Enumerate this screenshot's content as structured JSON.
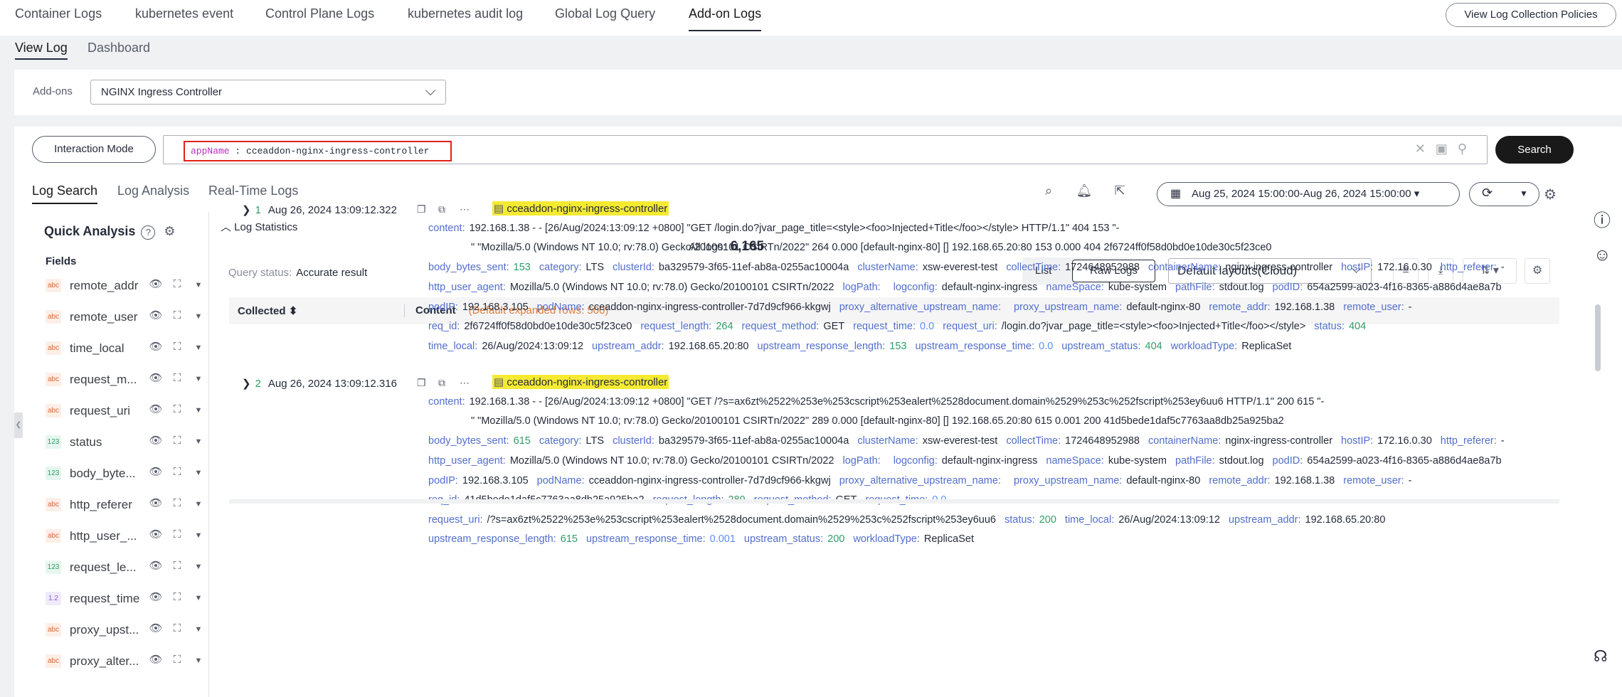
{
  "top_tabs": [
    "Container Logs",
    "kubernetes event",
    "Control Plane Logs",
    "kubernetes audit log",
    "Global Log Query",
    "Add-on Logs"
  ],
  "view_log_collection": "View Log Collection Policies",
  "sub_tabs": [
    "View Log",
    "Dashboard"
  ],
  "addons": {
    "label": "Add-ons",
    "selected": "NGINX Ingress Controller"
  },
  "interaction_mode": "Interaction Mode",
  "query": {
    "key": "appName",
    "rest": " : cceaddon-nginx-ingress-controller"
  },
  "search_label": "Search",
  "log_tabs": [
    "Log Search",
    "Log Analysis",
    "Real-Time Logs"
  ],
  "time_range": "Aug 25, 2024 15:00:00-Aug 26, 2024 15:00:00 ▾",
  "quick_analysis": {
    "title": "Quick Analysis",
    "fields_label": "Fields",
    "fields": [
      {
        "type": "abc",
        "name": "remote_addr"
      },
      {
        "type": "abc",
        "name": "remote_user"
      },
      {
        "type": "abc",
        "name": "time_local"
      },
      {
        "type": "abc",
        "name": "request_m..."
      },
      {
        "type": "abc",
        "name": "request_uri"
      },
      {
        "type": "123",
        "name": "status"
      },
      {
        "type": "123",
        "name": "body_byte..."
      },
      {
        "type": "abc",
        "name": "http_referer"
      },
      {
        "type": "abc",
        "name": "http_user_..."
      },
      {
        "type": "123",
        "name": "request_le..."
      },
      {
        "type": "1.2",
        "name": "request_time"
      },
      {
        "type": "abc",
        "name": "proxy_upst..."
      },
      {
        "type": "abc",
        "name": "proxy_alter..."
      }
    ]
  },
  "log_statistics": "Log Statistics",
  "all_logs": {
    "label": "All logs:",
    "count": "6,165"
  },
  "query_status": {
    "label": "Query status:",
    "value": "Accurate result"
  },
  "view_modes": {
    "list": "List",
    "raw": "Raw Logs"
  },
  "layout_select": "Default layouts(Cloud)",
  "table": {
    "col_collected": "Collected",
    "col_content": "Content",
    "expanded_note": "(Default expanded rows: 500)"
  },
  "rows": [
    {
      "num": "1",
      "time": "Aug 26, 2024 13:09:12.322",
      "app": "cceaddon-nginx-ingress-controller",
      "content1": "192.168.1.38 - - [26/Aug/2024:13:09:12 +0800] \"GET /login.do?jvar_page_title=<style><foo>Injected+Title</foo></style> HTTP/1.1\" 404 153 \"-",
      "content2": "\" \"Mozilla/5.0 (Windows NT 10.0; rv:78.0) Gecko/20100101 CSIRTn/2022\" 264 0.000 [default-nginx-80] [] 192.168.65.20:80 153 0.000 404 2f6724ff0f58d0bd0e10de30c5f23ce0",
      "body_bytes_sent": "153",
      "category": "LTS",
      "clusterId": "ba329579-3f65-11ef-ab8a-0255ac10004a",
      "clusterName": "xsw-everest-test",
      "collectTime": "1724648952988",
      "containerName": "nginx-ingress-controller",
      "hostIP": "172.16.0.30",
      "http_referer": "-",
      "http_user_agent": "Mozilla/5.0 (Windows NT 10.0; rv:78.0) Gecko/20100101 CSIRTn/2022",
      "logPath": "",
      "logconfig": "default-nginx-ingress",
      "nameSpace": "kube-system",
      "pathFile": "stdout.log",
      "podID": "654a2599-a023-4f16-8365-a886d4ae8a7b",
      "podIP": "192.168.3.105",
      "podName": "cceaddon-nginx-ingress-controller-7d7d9cf966-kkgwj",
      "proxy_alternative_upstream_name": "",
      "proxy_upstream_name": "default-nginx-80",
      "remote_addr": "192.168.1.38",
      "remote_user": "-",
      "req_id": "2f6724ff0f58d0bd0e10de30c5f23ce0",
      "request_length": "264",
      "request_method": "GET",
      "request_time": "0.0",
      "request_uri": "/login.do?jvar_page_title=<style><foo>Injected+Title</foo></style>",
      "status": "404",
      "time_local": "26/Aug/2024:13:09:12",
      "upstream_addr": "192.168.65.20:80",
      "upstream_response_length": "153",
      "upstream_response_time": "0.0",
      "upstream_status": "404",
      "workloadType": "ReplicaSet"
    },
    {
      "num": "2",
      "time": "Aug 26, 2024 13:09:12.316",
      "app": "cceaddon-nginx-ingress-controller",
      "content1": "192.168.1.38 - - [26/Aug/2024:13:09:12 +0800] \"GET /?s=ax6zt%2522%253e%253cscript%253ealert%2528document.domain%2529%253c%252fscript%253ey6uu6 HTTP/1.1\" 200 615 \"-",
      "content2": "\" \"Mozilla/5.0 (Windows NT 10.0; rv:78.0) Gecko/20100101 CSIRTn/2022\" 289 0.000 [default-nginx-80] [] 192.168.65.20:80 615 0.001 200 41d5bede1daf5c7763aa8db25a925ba2",
      "body_bytes_sent": "615",
      "category": "LTS",
      "clusterId": "ba329579-3f65-11ef-ab8a-0255ac10004a",
      "clusterName": "xsw-everest-test",
      "collectTime": "1724648952988",
      "containerName": "nginx-ingress-controller",
      "hostIP": "172.16.0.30",
      "http_referer": "-",
      "http_user_agent": "Mozilla/5.0 (Windows NT 10.0; rv:78.0) Gecko/20100101 CSIRTn/2022",
      "logPath": "",
      "logconfig": "default-nginx-ingress",
      "nameSpace": "kube-system",
      "pathFile": "stdout.log",
      "podID": "654a2599-a023-4f16-8365-a886d4ae8a7b",
      "podIP": "192.168.3.105",
      "podName": "cceaddon-nginx-ingress-controller-7d7d9cf966-kkgwj",
      "proxy_alternative_upstream_name": "",
      "proxy_upstream_name": "default-nginx-80",
      "remote_addr": "192.168.1.38",
      "remote_user": "-",
      "req_id": "41d5bede1daf5c7763aa8db25a925ba2",
      "request_length": "289",
      "request_method": "GET",
      "request_time": "0.0",
      "request_uri": "/?s=ax6zt%2522%253e%253cscript%253ealert%2528document.domain%2529%253c%252fscript%253ey6uu6",
      "status": "200",
      "time_local": "26/Aug/2024:13:09:12",
      "upstream_addr": "192.168.65.20:80",
      "upstream_response_length": "615",
      "upstream_response_time": "0.001",
      "upstream_status": "200",
      "workloadType": "ReplicaSet"
    }
  ]
}
